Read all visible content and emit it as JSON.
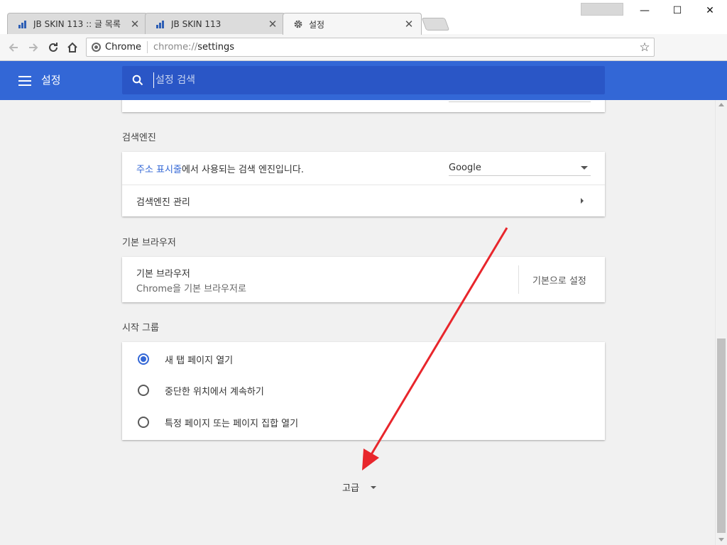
{
  "window": {
    "tabs": [
      {
        "title": "JB SKIN 113 :: 글 목록",
        "icon": "blog-favicon-icon"
      },
      {
        "title": "JB SKIN 113",
        "icon": "blog-favicon-icon"
      },
      {
        "title": "설정",
        "icon": "gear-icon"
      }
    ],
    "controls": {
      "minimize": "—",
      "maximize": "☐",
      "close": "✕"
    }
  },
  "toolbar": {
    "chip": "Chrome",
    "url_scheme": "chrome://",
    "url_host": "settings",
    "star": "☆"
  },
  "header": {
    "title": "설정",
    "search_placeholder": "설정 검색"
  },
  "sections": {
    "search_engine": {
      "title": "검색엔진",
      "row1_link": "주소 표시줄",
      "row1_rest": "에서 사용되는 검색 엔진입니다.",
      "selected": "Google",
      "row2": "검색엔진 관리"
    },
    "default_browser": {
      "title": "기본 브라우저",
      "label": "기본 브라우저",
      "sublabel": "Chrome을 기본 브라우저로",
      "button": "기본으로 설정"
    },
    "startup": {
      "title": "시작 그룹",
      "options": [
        {
          "label": "새 탭 페이지 열기",
          "checked": true
        },
        {
          "label": "중단한 위치에서 계속하기",
          "checked": false
        },
        {
          "label": "특정 페이지 또는 페이지 집합 열기",
          "checked": false
        }
      ]
    }
  },
  "advanced": {
    "label": "고급"
  },
  "colors": {
    "header": "#3367d6",
    "search": "#2a56c6",
    "accent": "#3367d6",
    "annotation_arrow": "#e8262c"
  }
}
